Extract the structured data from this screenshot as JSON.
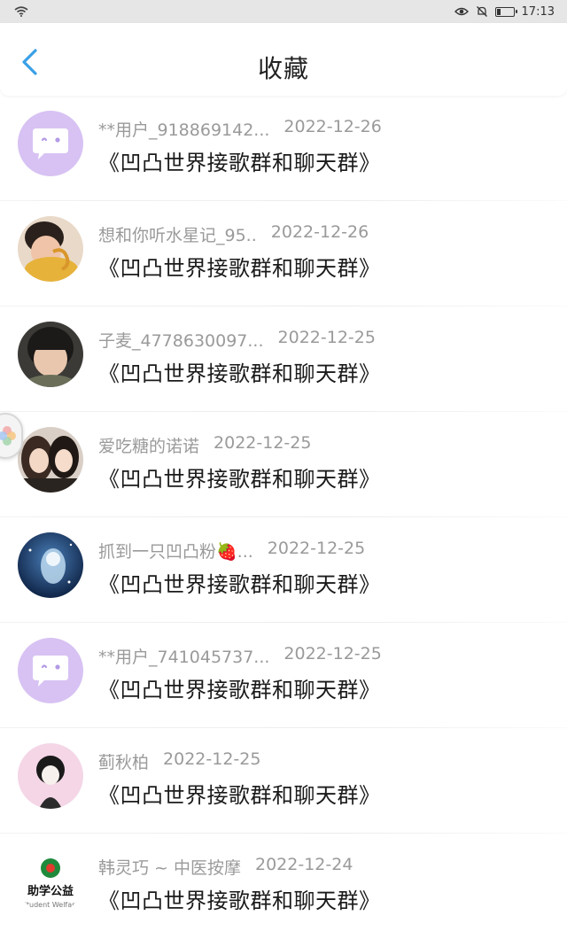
{
  "status_bar": {
    "time": "17:13"
  },
  "header": {
    "title": "收藏"
  },
  "items": [
    {
      "name": "**用户_918869142...",
      "date": "2022-12-26",
      "message": "《凹凸世界接歌群和聊天群》"
    },
    {
      "name": "想和你听水星记_95..",
      "date": "2022-12-26",
      "message": "《凹凸世界接歌群和聊天群》"
    },
    {
      "name": "子麦_4778630097...",
      "date": "2022-12-25",
      "message": "《凹凸世界接歌群和聊天群》"
    },
    {
      "name": "爱吃糖的诺诺",
      "date": "2022-12-25",
      "message": "《凹凸世界接歌群和聊天群》"
    },
    {
      "name": "抓到一只凹凸粉🍓...",
      "date": "2022-12-25",
      "message": "《凹凸世界接歌群和聊天群》"
    },
    {
      "name": "**用户_741045737...",
      "date": "2022-12-25",
      "message": "《凹凸世界接歌群和聊天群》"
    },
    {
      "name": "蓟秋柏",
      "date": "2022-12-25",
      "message": "《凹凸世界接歌群和聊天群》"
    },
    {
      "name": "韩灵巧 ~ 中医按摩",
      "date": "2022-12-24",
      "message": "《凹凸世界接歌群和聊天群》"
    }
  ],
  "avatar_logo_text": {
    "cn": "助学公益",
    "en": "Student Welfare"
  },
  "colors": {
    "accent": "#3aa0e6",
    "default_avatar": "#d7c2f3",
    "meta_text": "#9a9a9a"
  }
}
